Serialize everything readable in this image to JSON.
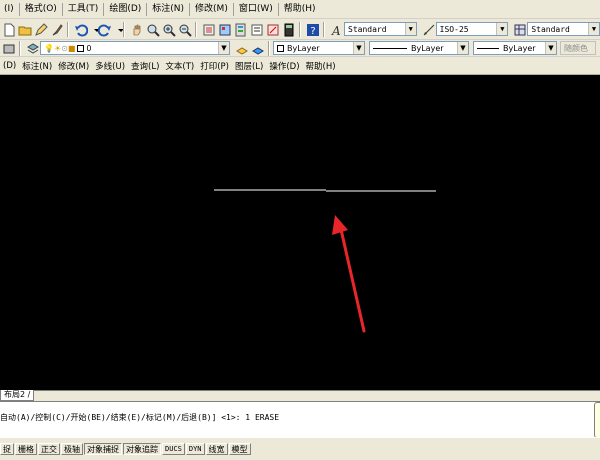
{
  "menubar": {
    "items": [
      "(I)",
      "格式(O)",
      "工具(T)",
      "绘图(D)",
      "标注(N)",
      "修改(M)",
      "窗口(W)",
      "帮助(H)"
    ]
  },
  "styles": {
    "text_style": "Standard",
    "dim_style": "ISO-25",
    "table_style": "Standard"
  },
  "layers": {
    "current_layer": "0",
    "color": "ByLayer",
    "linetype": "ByLayer",
    "lineweight": "ByLayer",
    "plot_style": "随颜色"
  },
  "menu2": {
    "items": [
      "(D)",
      "标注(N)",
      "修改(M)",
      "多线(U)",
      "查询(L)",
      "文本(T)",
      "打印(P)",
      "图层(L)",
      "操作(D)",
      "帮助(H)"
    ]
  },
  "layout_tabs": {
    "active": "布局2"
  },
  "command": {
    "line": "自动(A)/控制(C)/开始(BE)/结束(E)/标记(M)/后退(B)] <1>: 1 ERASE"
  },
  "status": {
    "buttons": [
      "捉",
      "栅格",
      "正交",
      "极轴",
      "对象捕捉",
      "对象追踪",
      "DUCS",
      "DYN",
      "线宽",
      "模型"
    ]
  },
  "colors": {
    "canvas": "#000000",
    "drawn_line": "#ffffff",
    "annotation_arrow": "#e8262a"
  }
}
